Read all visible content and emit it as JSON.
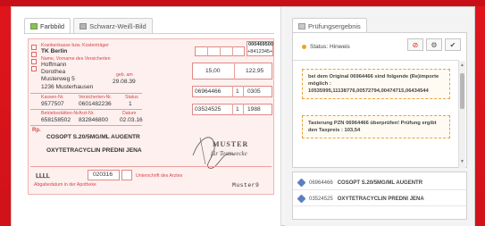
{
  "tabs": [
    {
      "label": "Farbbild",
      "icon": "image-color-icon"
    },
    {
      "label": "Schwarz-Weiß-Bild",
      "icon": "image-bw-icon"
    }
  ],
  "form": {
    "kasse": "TK Berlin",
    "topright_code": "000469500",
    "topright_code2": "+8412345+",
    "name_last": "Hoffmann",
    "name_first": "Dorothea",
    "street": "Musterweg 5",
    "city": "1236 Musterhausen",
    "birth": "29.08.39",
    "kassen_nr": "9577507",
    "versicherten_nr": "0601482236",
    "status": "1",
    "betriebsst": "658158502",
    "arzt_nr": "832846800",
    "datum": "02.03.16",
    "rx_line1": "COSOPT S.20/5MG/ML AUGENTR",
    "rx_line2": "OXYTETRACYCLIN PREDNI JENA",
    "price_1": "15,00",
    "price_2": "122,95",
    "pzn_1": "06964466",
    "qty_1": "1",
    "faktor_1": "0305",
    "pzn_2": "03524525",
    "qty_2": "1",
    "faktor_2": "1988",
    "sig": "",
    "code_bottom": "020316",
    "stamp_line1": "MUSTER",
    "stamp_line2": "für Testzwecke",
    "muster_label": "Muster9"
  },
  "right": {
    "tab_label": "Prüfungsergebnis",
    "status_label": "Status: Hinweis",
    "buttons": [
      "cancel",
      "settings",
      "confirm"
    ],
    "message1": "bei dem Original 06964466 sind folgende (Re)importe möglich : 10535995,11138776,00572794,00474715,06434544",
    "message2": "Taxierung PZN 06964466 überprüfen! Prüfung ergibt den Taxpreis : 103,54",
    "list": [
      {
        "pzn": "06964466",
        "name": "COSOPT S.20/5MG/ML AUGENTR"
      },
      {
        "pzn": "03524525",
        "name": "OXYTETRACYCLIN PREDNI JENA"
      }
    ]
  },
  "colors": {
    "background": "#e4141c",
    "form_red": "#d44848",
    "accent_orange": "#f2a024"
  }
}
